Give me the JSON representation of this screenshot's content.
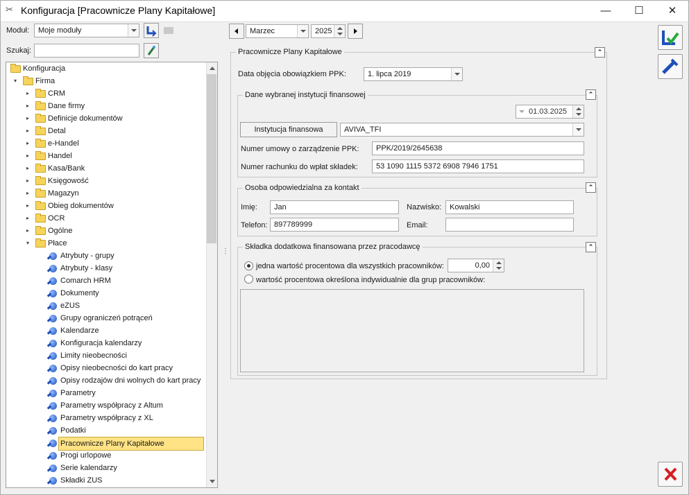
{
  "window": {
    "title": "Konfiguracja [Pracownicze Plany Kapitałowe]",
    "minimize": "—",
    "maximize": "☐",
    "close": "✕"
  },
  "toolbar": {
    "module_label": "Moduł:",
    "module_value": "Moje moduły",
    "search_label": "Szukaj:",
    "search_value": "",
    "month_value": "Marzec",
    "year_value": "2025"
  },
  "tree": {
    "items": [
      {
        "label": "Konfiguracja",
        "type": "folder",
        "level": 0,
        "arrow": ""
      },
      {
        "label": "Firma",
        "type": "folder",
        "level": 1,
        "arrow": "▾"
      },
      {
        "label": "CRM",
        "type": "folder",
        "level": 2,
        "arrow": "▸"
      },
      {
        "label": "Dane firmy",
        "type": "folder",
        "level": 2,
        "arrow": "▸"
      },
      {
        "label": "Definicje dokumentów",
        "type": "folder",
        "level": 2,
        "arrow": "▸"
      },
      {
        "label": "Detal",
        "type": "folder",
        "level": 2,
        "arrow": "▸"
      },
      {
        "label": "e-Handel",
        "type": "folder",
        "level": 2,
        "arrow": "▸"
      },
      {
        "label": "Handel",
        "type": "folder",
        "level": 2,
        "arrow": "▸"
      },
      {
        "label": "Kasa/Bank",
        "type": "folder",
        "level": 2,
        "arrow": "▸"
      },
      {
        "label": "Księgowość",
        "type": "folder",
        "level": 2,
        "arrow": "▸"
      },
      {
        "label": "Magazyn",
        "type": "folder",
        "level": 2,
        "arrow": "▸"
      },
      {
        "label": "Obieg dokumentów",
        "type": "folder",
        "level": 2,
        "arrow": "▸"
      },
      {
        "label": "OCR",
        "type": "folder",
        "level": 2,
        "arrow": "▸"
      },
      {
        "label": "Ogólne",
        "type": "folder",
        "level": 2,
        "arrow": "▸"
      },
      {
        "label": "Płace",
        "type": "folder",
        "level": 2,
        "arrow": "▾"
      },
      {
        "label": "Atrybuty - grupy",
        "type": "leaf",
        "level": 3,
        "arrow": ""
      },
      {
        "label": "Atrybuty - klasy",
        "type": "leaf",
        "level": 3,
        "arrow": ""
      },
      {
        "label": "Comarch HRM",
        "type": "leaf",
        "level": 3,
        "arrow": ""
      },
      {
        "label": "Dokumenty",
        "type": "leaf",
        "level": 3,
        "arrow": ""
      },
      {
        "label": "eZUS",
        "type": "leaf",
        "level": 3,
        "arrow": ""
      },
      {
        "label": "Grupy ograniczeń potrąceń",
        "type": "leaf",
        "level": 3,
        "arrow": ""
      },
      {
        "label": "Kalendarze",
        "type": "leaf",
        "level": 3,
        "arrow": ""
      },
      {
        "label": "Konfiguracja kalendarzy",
        "type": "leaf",
        "level": 3,
        "arrow": ""
      },
      {
        "label": "Limity nieobecności",
        "type": "leaf",
        "level": 3,
        "arrow": ""
      },
      {
        "label": "Opisy nieobecności do kart pracy",
        "type": "leaf",
        "level": 3,
        "arrow": ""
      },
      {
        "label": "Opisy rodzajów dni wolnych do kart pracy",
        "type": "leaf",
        "level": 3,
        "arrow": ""
      },
      {
        "label": "Parametry",
        "type": "leaf",
        "level": 3,
        "arrow": ""
      },
      {
        "label": "Parametry współpracy z Altum",
        "type": "leaf",
        "level": 3,
        "arrow": ""
      },
      {
        "label": "Parametry współpracy z XL",
        "type": "leaf",
        "level": 3,
        "arrow": ""
      },
      {
        "label": "Podatki",
        "type": "leaf",
        "level": 3,
        "arrow": ""
      },
      {
        "label": "Pracownicze Plany Kapitałowe",
        "type": "leaf",
        "level": 3,
        "arrow": "",
        "selected": true
      },
      {
        "label": "Progi urlopowe",
        "type": "leaf",
        "level": 3,
        "arrow": ""
      },
      {
        "label": "Serie kalendarzy",
        "type": "leaf",
        "level": 3,
        "arrow": ""
      },
      {
        "label": "Składki ZUS",
        "type": "leaf",
        "level": 3,
        "arrow": ""
      }
    ]
  },
  "ppk": {
    "group_title": "Pracownicze Plany Kapitałowe",
    "date_label": "Data objęcia obowiązkiem PPK:",
    "date_value": "1. lipca 2019",
    "institution": {
      "group_title": "Dane wybranej instytucji finansowej",
      "date_value": "01.03.2025",
      "button_label": "Instytucja finansowa",
      "institution_value": "AVIVA_TFI",
      "agreement_label": "Numer umowy o zarządzenie PPK:",
      "agreement_value": "PPK/2019/2645638",
      "account_label": "Numer rachunku do wpłat składek:",
      "account_value": "53 1090 1115 5372 6908 7946 1751"
    },
    "contact": {
      "group_title": "Osoba odpowiedzialna za kontakt",
      "first_name_label": "Imię:",
      "first_name_value": "Jan",
      "last_name_label": "Nazwisko:",
      "last_name_value": "Kowalski",
      "phone_label": "Telefon:",
      "phone_value": "897789999",
      "email_label": "Email:",
      "email_value": ""
    },
    "contribution": {
      "group_title": "Składka dodatkowa finansowana przez pracodawcę",
      "option1_label": "jedna wartość procentowa dla wszystkich pracowników:",
      "option1_value": "0,00",
      "option2_label": "wartość procentowa określona indywidualnie dla grup pracowników:"
    }
  },
  "icons": {
    "save": "save-icon",
    "edit": "edit-icon",
    "cancel": "close-icon"
  },
  "colors": {
    "selection": "#ffe385",
    "accent": "#1f50b8",
    "cancel": "#d42020"
  }
}
